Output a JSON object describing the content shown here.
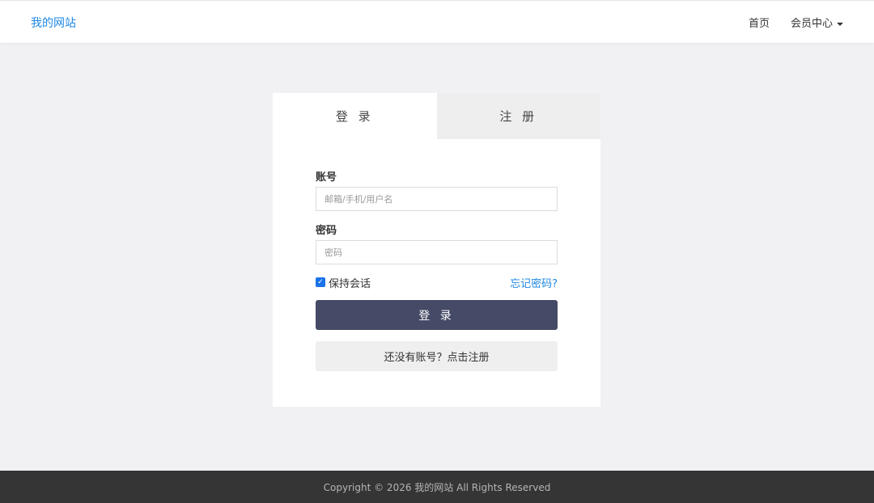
{
  "header": {
    "brand": "我的网站",
    "nav": {
      "home": "首页",
      "member_center": "会员中心"
    }
  },
  "login_card": {
    "tabs": {
      "login": "登 录",
      "register": "注 册"
    },
    "account": {
      "label": "账号",
      "placeholder": "邮箱/手机/用户名",
      "value": ""
    },
    "password": {
      "label": "密码",
      "placeholder": "密码",
      "value": ""
    },
    "remember": {
      "label": "保持会话",
      "checked": true
    },
    "forgot_link": "忘记密码?",
    "login_button": "登 录",
    "register_button": "还没有账号？点击注册"
  },
  "footer": {
    "copyright": "Copyright © 2026 我的网站 All Rights Reserved"
  },
  "colors": {
    "brand": "#1e88e5",
    "primary_button": "#454a66",
    "checkbox": "#1a73e8",
    "footer_bg": "#353535"
  }
}
